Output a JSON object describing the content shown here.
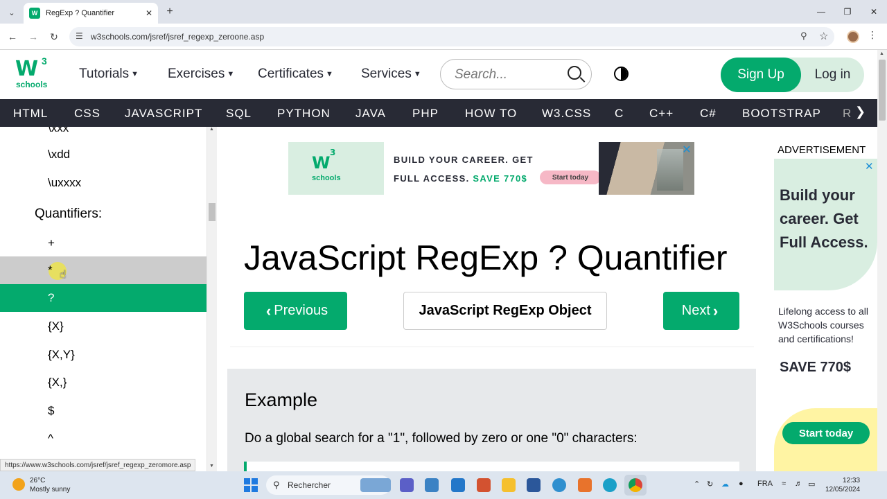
{
  "browser": {
    "tab_title": "RegExp ? Quantifier",
    "favicon_text": "W",
    "url": "w3schools.com/jsref/jsref_regexp_zeroone.asp",
    "status_url": "https://www.w3schools.com/jsref/jsref_regexp_zeromore.asp"
  },
  "header": {
    "logo_main": "W",
    "logo_sup": "3",
    "logo_sub": "schools",
    "menu": [
      "Tutorials",
      "Exercises",
      "Certificates",
      "Services"
    ],
    "search_placeholder": "Search...",
    "signup": "Sign Up",
    "login": "Log in"
  },
  "subnav": [
    "HTML",
    "CSS",
    "JAVASCRIPT",
    "SQL",
    "PYTHON",
    "JAVA",
    "PHP",
    "HOW TO",
    "W3.CSS",
    "C",
    "C++",
    "C#",
    "BOOTSTRAP",
    "R"
  ],
  "sidebar": {
    "items_top": [
      "\\xxx",
      "\\xdd",
      "\\uxxxx"
    ],
    "heading": "Quantifiers:",
    "items": [
      "+",
      "*",
      "?",
      "{X}",
      "{X,Y}",
      "{X,}",
      "$",
      "^"
    ]
  },
  "banner": {
    "logo_main": "W",
    "logo_sup": "3",
    "logo_sub": "schools",
    "line1": "BUILD YOUR CAREER. GET",
    "line2": "FULL ACCESS.",
    "line2_hl": "SAVE 770$",
    "cta": "Start today"
  },
  "main": {
    "title": "JavaScript RegExp ? Quantifier",
    "prev": "Previous",
    "middle": "JavaScript RegExp Object",
    "next": "Next",
    "example_heading": "Example",
    "example_text": "Do a global search for a \"1\", followed by zero or one \"0\" characters:"
  },
  "ad": {
    "label": "ADVERTISEMENT",
    "headline": "Build your career. Get Full Access.",
    "body": "Lifelong access to all W3Schools courses and certifications!",
    "save": "SAVE 770$",
    "cta": "Start today"
  },
  "taskbar": {
    "temp": "26°C",
    "weather": "Mostly sunny",
    "search": "Rechercher",
    "lang": "FRA",
    "time": "12:33",
    "date": "12/05/2024"
  },
  "colors": {
    "w3_green": "#04aa6d",
    "dark_nav": "#282a35",
    "example_bg": "#e7e9eb",
    "hover_grey": "#cccccc"
  }
}
